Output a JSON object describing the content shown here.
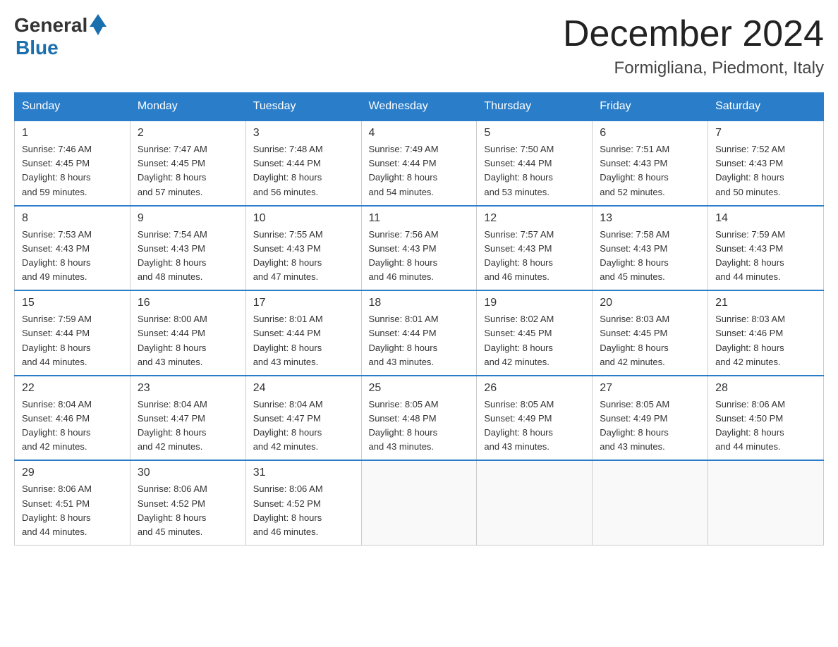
{
  "header": {
    "logo_general": "General",
    "logo_blue": "Blue",
    "title": "December 2024",
    "subtitle": "Formigliana, Piedmont, Italy"
  },
  "days_of_week": [
    "Sunday",
    "Monday",
    "Tuesday",
    "Wednesday",
    "Thursday",
    "Friday",
    "Saturday"
  ],
  "weeks": [
    [
      {
        "day": "1",
        "sunrise": "7:46 AM",
        "sunset": "4:45 PM",
        "daylight_hours": "8",
        "daylight_minutes": "59"
      },
      {
        "day": "2",
        "sunrise": "7:47 AM",
        "sunset": "4:45 PM",
        "daylight_hours": "8",
        "daylight_minutes": "57"
      },
      {
        "day": "3",
        "sunrise": "7:48 AM",
        "sunset": "4:44 PM",
        "daylight_hours": "8",
        "daylight_minutes": "56"
      },
      {
        "day": "4",
        "sunrise": "7:49 AM",
        "sunset": "4:44 PM",
        "daylight_hours": "8",
        "daylight_minutes": "54"
      },
      {
        "day": "5",
        "sunrise": "7:50 AM",
        "sunset": "4:44 PM",
        "daylight_hours": "8",
        "daylight_minutes": "53"
      },
      {
        "day": "6",
        "sunrise": "7:51 AM",
        "sunset": "4:43 PM",
        "daylight_hours": "8",
        "daylight_minutes": "52"
      },
      {
        "day": "7",
        "sunrise": "7:52 AM",
        "sunset": "4:43 PM",
        "daylight_hours": "8",
        "daylight_minutes": "50"
      }
    ],
    [
      {
        "day": "8",
        "sunrise": "7:53 AM",
        "sunset": "4:43 PM",
        "daylight_hours": "8",
        "daylight_minutes": "49"
      },
      {
        "day": "9",
        "sunrise": "7:54 AM",
        "sunset": "4:43 PM",
        "daylight_hours": "8",
        "daylight_minutes": "48"
      },
      {
        "day": "10",
        "sunrise": "7:55 AM",
        "sunset": "4:43 PM",
        "daylight_hours": "8",
        "daylight_minutes": "47"
      },
      {
        "day": "11",
        "sunrise": "7:56 AM",
        "sunset": "4:43 PM",
        "daylight_hours": "8",
        "daylight_minutes": "46"
      },
      {
        "day": "12",
        "sunrise": "7:57 AM",
        "sunset": "4:43 PM",
        "daylight_hours": "8",
        "daylight_minutes": "46"
      },
      {
        "day": "13",
        "sunrise": "7:58 AM",
        "sunset": "4:43 PM",
        "daylight_hours": "8",
        "daylight_minutes": "45"
      },
      {
        "day": "14",
        "sunrise": "7:59 AM",
        "sunset": "4:43 PM",
        "daylight_hours": "8",
        "daylight_minutes": "44"
      }
    ],
    [
      {
        "day": "15",
        "sunrise": "7:59 AM",
        "sunset": "4:44 PM",
        "daylight_hours": "8",
        "daylight_minutes": "44"
      },
      {
        "day": "16",
        "sunrise": "8:00 AM",
        "sunset": "4:44 PM",
        "daylight_hours": "8",
        "daylight_minutes": "43"
      },
      {
        "day": "17",
        "sunrise": "8:01 AM",
        "sunset": "4:44 PM",
        "daylight_hours": "8",
        "daylight_minutes": "43"
      },
      {
        "day": "18",
        "sunrise": "8:01 AM",
        "sunset": "4:44 PM",
        "daylight_hours": "8",
        "daylight_minutes": "43"
      },
      {
        "day": "19",
        "sunrise": "8:02 AM",
        "sunset": "4:45 PM",
        "daylight_hours": "8",
        "daylight_minutes": "42"
      },
      {
        "day": "20",
        "sunrise": "8:03 AM",
        "sunset": "4:45 PM",
        "daylight_hours": "8",
        "daylight_minutes": "42"
      },
      {
        "day": "21",
        "sunrise": "8:03 AM",
        "sunset": "4:46 PM",
        "daylight_hours": "8",
        "daylight_minutes": "42"
      }
    ],
    [
      {
        "day": "22",
        "sunrise": "8:04 AM",
        "sunset": "4:46 PM",
        "daylight_hours": "8",
        "daylight_minutes": "42"
      },
      {
        "day": "23",
        "sunrise": "8:04 AM",
        "sunset": "4:47 PM",
        "daylight_hours": "8",
        "daylight_minutes": "42"
      },
      {
        "day": "24",
        "sunrise": "8:04 AM",
        "sunset": "4:47 PM",
        "daylight_hours": "8",
        "daylight_minutes": "42"
      },
      {
        "day": "25",
        "sunrise": "8:05 AM",
        "sunset": "4:48 PM",
        "daylight_hours": "8",
        "daylight_minutes": "43"
      },
      {
        "day": "26",
        "sunrise": "8:05 AM",
        "sunset": "4:49 PM",
        "daylight_hours": "8",
        "daylight_minutes": "43"
      },
      {
        "day": "27",
        "sunrise": "8:05 AM",
        "sunset": "4:49 PM",
        "daylight_hours": "8",
        "daylight_minutes": "43"
      },
      {
        "day": "28",
        "sunrise": "8:06 AM",
        "sunset": "4:50 PM",
        "daylight_hours": "8",
        "daylight_minutes": "44"
      }
    ],
    [
      {
        "day": "29",
        "sunrise": "8:06 AM",
        "sunset": "4:51 PM",
        "daylight_hours": "8",
        "daylight_minutes": "44"
      },
      {
        "day": "30",
        "sunrise": "8:06 AM",
        "sunset": "4:52 PM",
        "daylight_hours": "8",
        "daylight_minutes": "45"
      },
      {
        "day": "31",
        "sunrise": "8:06 AM",
        "sunset": "4:52 PM",
        "daylight_hours": "8",
        "daylight_minutes": "46"
      },
      null,
      null,
      null,
      null
    ]
  ],
  "labels": {
    "sunrise": "Sunrise:",
    "sunset": "Sunset:",
    "daylight": "Daylight:",
    "hours_suffix": "hours",
    "and": "and",
    "minutes_suffix": "minutes."
  }
}
